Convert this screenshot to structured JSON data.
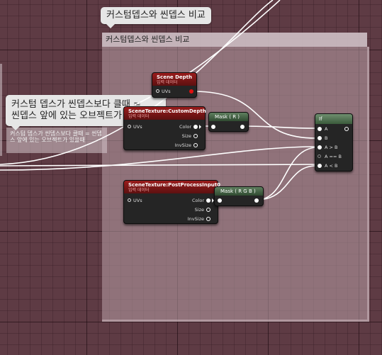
{
  "comment": {
    "bubble_text": "커스텀뎁스와 씬뎁스 비교",
    "header_text": "커스텀뎁스와 씬뎁스 비교"
  },
  "left_comment": {
    "bubble_line1": "커스텀 뎁스가 씬뎁스보다 클때 =",
    "bubble_line2": "씬뎁스 앞에 있는 오브젝트가",
    "body_text": "커스텀 뎁스가 씬뎁스보다 클때 = 씬뎁스 앞에 있는 오브젝트가 있을때"
  },
  "nodes": {
    "scene_depth": {
      "title": "Scene Depth",
      "subtitle": "입력 데이터",
      "input_uvs": "UVs"
    },
    "custom_depth": {
      "title": "SceneTexture:CustomDepth",
      "subtitle": "입력 데이터",
      "input_uvs": "UVs",
      "out_color": "Color",
      "out_size": "Size",
      "out_invsize": "InvSize"
    },
    "post_process": {
      "title": "SceneTexture:PostProcessInput0",
      "subtitle": "입력 데이터",
      "input_uvs": "UVs",
      "out_color": "Color",
      "out_size": "Size",
      "out_invsize": "InvSize"
    },
    "mask_r": {
      "title": "Mask ( R )"
    },
    "mask_rgb": {
      "title": "Mask ( R G B )"
    },
    "if_node": {
      "title": "If",
      "in_a": "A",
      "in_b": "B",
      "in_a_gt_b": "A > B",
      "in_a_eq_b": "A == B",
      "in_a_lt_b": "A < B"
    }
  },
  "colors": {
    "background": "#5e3b44",
    "texture_node_header": "#9a1c1c",
    "math_node_header": "#5f7f5f",
    "wire": "#ffffff",
    "depth_pin": "#e01010"
  }
}
